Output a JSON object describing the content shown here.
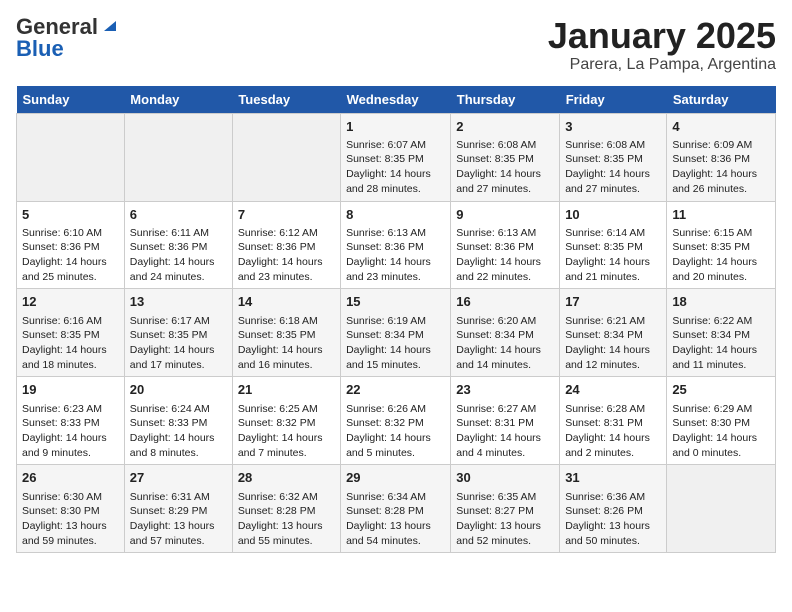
{
  "logo": {
    "general": "General",
    "blue": "Blue"
  },
  "title": "January 2025",
  "location": "Parera, La Pampa, Argentina",
  "days_of_week": [
    "Sunday",
    "Monday",
    "Tuesday",
    "Wednesday",
    "Thursday",
    "Friday",
    "Saturday"
  ],
  "weeks": [
    [
      {
        "day": "",
        "info": ""
      },
      {
        "day": "",
        "info": ""
      },
      {
        "day": "",
        "info": ""
      },
      {
        "day": "1",
        "info": "Sunrise: 6:07 AM\nSunset: 8:35 PM\nDaylight: 14 hours and 28 minutes."
      },
      {
        "day": "2",
        "info": "Sunrise: 6:08 AM\nSunset: 8:35 PM\nDaylight: 14 hours and 27 minutes."
      },
      {
        "day": "3",
        "info": "Sunrise: 6:08 AM\nSunset: 8:35 PM\nDaylight: 14 hours and 27 minutes."
      },
      {
        "day": "4",
        "info": "Sunrise: 6:09 AM\nSunset: 8:36 PM\nDaylight: 14 hours and 26 minutes."
      }
    ],
    [
      {
        "day": "5",
        "info": "Sunrise: 6:10 AM\nSunset: 8:36 PM\nDaylight: 14 hours and 25 minutes."
      },
      {
        "day": "6",
        "info": "Sunrise: 6:11 AM\nSunset: 8:36 PM\nDaylight: 14 hours and 24 minutes."
      },
      {
        "day": "7",
        "info": "Sunrise: 6:12 AM\nSunset: 8:36 PM\nDaylight: 14 hours and 23 minutes."
      },
      {
        "day": "8",
        "info": "Sunrise: 6:13 AM\nSunset: 8:36 PM\nDaylight: 14 hours and 23 minutes."
      },
      {
        "day": "9",
        "info": "Sunrise: 6:13 AM\nSunset: 8:36 PM\nDaylight: 14 hours and 22 minutes."
      },
      {
        "day": "10",
        "info": "Sunrise: 6:14 AM\nSunset: 8:35 PM\nDaylight: 14 hours and 21 minutes."
      },
      {
        "day": "11",
        "info": "Sunrise: 6:15 AM\nSunset: 8:35 PM\nDaylight: 14 hours and 20 minutes."
      }
    ],
    [
      {
        "day": "12",
        "info": "Sunrise: 6:16 AM\nSunset: 8:35 PM\nDaylight: 14 hours and 18 minutes."
      },
      {
        "day": "13",
        "info": "Sunrise: 6:17 AM\nSunset: 8:35 PM\nDaylight: 14 hours and 17 minutes."
      },
      {
        "day": "14",
        "info": "Sunrise: 6:18 AM\nSunset: 8:35 PM\nDaylight: 14 hours and 16 minutes."
      },
      {
        "day": "15",
        "info": "Sunrise: 6:19 AM\nSunset: 8:34 PM\nDaylight: 14 hours and 15 minutes."
      },
      {
        "day": "16",
        "info": "Sunrise: 6:20 AM\nSunset: 8:34 PM\nDaylight: 14 hours and 14 minutes."
      },
      {
        "day": "17",
        "info": "Sunrise: 6:21 AM\nSunset: 8:34 PM\nDaylight: 14 hours and 12 minutes."
      },
      {
        "day": "18",
        "info": "Sunrise: 6:22 AM\nSunset: 8:34 PM\nDaylight: 14 hours and 11 minutes."
      }
    ],
    [
      {
        "day": "19",
        "info": "Sunrise: 6:23 AM\nSunset: 8:33 PM\nDaylight: 14 hours and 9 minutes."
      },
      {
        "day": "20",
        "info": "Sunrise: 6:24 AM\nSunset: 8:33 PM\nDaylight: 14 hours and 8 minutes."
      },
      {
        "day": "21",
        "info": "Sunrise: 6:25 AM\nSunset: 8:32 PM\nDaylight: 14 hours and 7 minutes."
      },
      {
        "day": "22",
        "info": "Sunrise: 6:26 AM\nSunset: 8:32 PM\nDaylight: 14 hours and 5 minutes."
      },
      {
        "day": "23",
        "info": "Sunrise: 6:27 AM\nSunset: 8:31 PM\nDaylight: 14 hours and 4 minutes."
      },
      {
        "day": "24",
        "info": "Sunrise: 6:28 AM\nSunset: 8:31 PM\nDaylight: 14 hours and 2 minutes."
      },
      {
        "day": "25",
        "info": "Sunrise: 6:29 AM\nSunset: 8:30 PM\nDaylight: 14 hours and 0 minutes."
      }
    ],
    [
      {
        "day": "26",
        "info": "Sunrise: 6:30 AM\nSunset: 8:30 PM\nDaylight: 13 hours and 59 minutes."
      },
      {
        "day": "27",
        "info": "Sunrise: 6:31 AM\nSunset: 8:29 PM\nDaylight: 13 hours and 57 minutes."
      },
      {
        "day": "28",
        "info": "Sunrise: 6:32 AM\nSunset: 8:28 PM\nDaylight: 13 hours and 55 minutes."
      },
      {
        "day": "29",
        "info": "Sunrise: 6:34 AM\nSunset: 8:28 PM\nDaylight: 13 hours and 54 minutes."
      },
      {
        "day": "30",
        "info": "Sunrise: 6:35 AM\nSunset: 8:27 PM\nDaylight: 13 hours and 52 minutes."
      },
      {
        "day": "31",
        "info": "Sunrise: 6:36 AM\nSunset: 8:26 PM\nDaylight: 13 hours and 50 minutes."
      },
      {
        "day": "",
        "info": ""
      }
    ]
  ]
}
